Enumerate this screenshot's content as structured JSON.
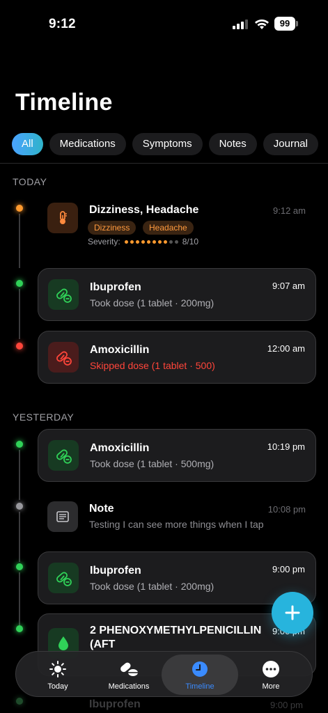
{
  "status": {
    "time": "9:12",
    "battery": "99"
  },
  "page": {
    "title": "Timeline"
  },
  "filters": [
    "All",
    "Medications",
    "Symptoms",
    "Notes",
    "Journal"
  ],
  "sections": {
    "today": "TODAY",
    "yesterday": "YESTERDAY"
  },
  "today": {
    "symptom": {
      "title": "Dizziness, Headache",
      "time": "9:12 am",
      "chips": [
        "Dizziness",
        "Headache"
      ],
      "severity_label": "Severity:",
      "severity_value": "8/10",
      "severity_level": 8,
      "severity_max": 10
    },
    "ibuprofen": {
      "title": "Ibuprofen",
      "time": "9:07 am",
      "sub": "Took dose (1 tablet · 200mg)"
    },
    "amoxicillin": {
      "title": "Amoxicillin",
      "time": "12:00 am",
      "sub": "Skipped dose (1 tablet · 500)"
    }
  },
  "yesterday": {
    "amoxicillin": {
      "title": "Amoxicillin",
      "time": "10:19 pm",
      "sub": "Took dose (1 tablet · 500mg)"
    },
    "note": {
      "title": "Note",
      "time": "10:08 pm",
      "sub": "Testing I can see more things when I tap"
    },
    "ibuprofen": {
      "title": "Ibuprofen",
      "time": "9:00 pm",
      "sub": "Took dose (1 tablet · 200mg)"
    },
    "penicillin": {
      "title_line1": "2 PHENOXYMETHYLPENICILLIN",
      "title_line2": "(AFT",
      "time": "9:00 pm"
    },
    "partial": {
      "title": "Ibuprofen",
      "time": "9:00 pm"
    }
  },
  "nav": {
    "today": "Today",
    "medications": "Medications",
    "timeline": "Timeline",
    "more": "More"
  },
  "colors": {
    "accent": "#27b4dd",
    "green": "#30d158",
    "red": "#ff453a",
    "orange": "#ff9a2e",
    "nav_active": "#3a8bff"
  }
}
